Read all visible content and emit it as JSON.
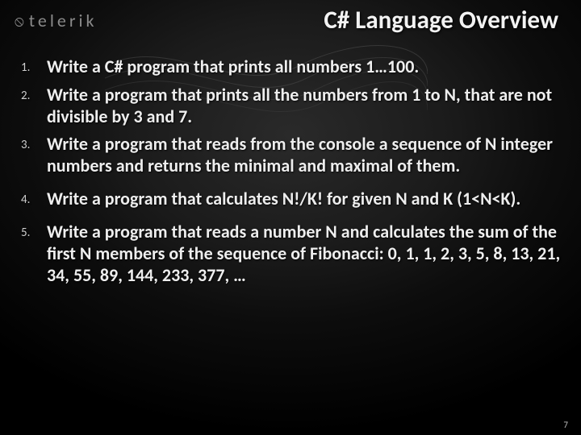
{
  "logo": {
    "mark": "⦸",
    "text": "telerik"
  },
  "title": "C# Language Overview",
  "items": [
    "Write a C# program that prints all numbers 1…100.",
    "Write a program that prints all the numbers from 1 to N, that are not divisible by 3 and 7.",
    "Write a program that reads from the console a sequence of N integer numbers and returns the minimal and maximal of them.",
    "Write a program that calculates N!/K! for given N and K (1<N<K).",
    "Write a program that reads a number N and calculates the sum of the first N members of the sequence of Fibonacci: 0, 1, 1, 2, 3, 5, 8, 13, 21, 34, 55, 89, 144, 233, 377, …"
  ],
  "page_number": "7"
}
